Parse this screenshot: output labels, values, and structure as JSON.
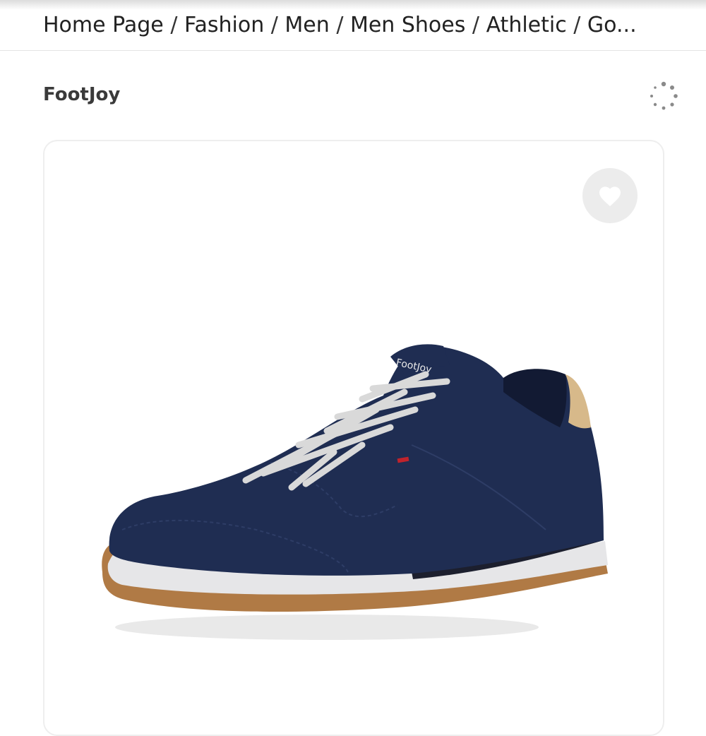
{
  "breadcrumb": {
    "items": [
      "Home Page",
      "Fashion",
      "Men",
      "Men Shoes",
      "Athletic",
      "Go..."
    ],
    "separator": "/"
  },
  "product": {
    "brand": "FootJoy",
    "shoe_logo_text": "FootJoy"
  },
  "icons": {
    "loading": "loading-spinner-icon",
    "favorite": "heart-icon"
  },
  "colors": {
    "shoe_upper": "#1f2d52",
    "laces": "#d9d9d9",
    "heel_tab": "#d7b98a",
    "midsole": "#e6e6e8",
    "outsole": "#b07a45",
    "fav_bg": "#ececec"
  }
}
